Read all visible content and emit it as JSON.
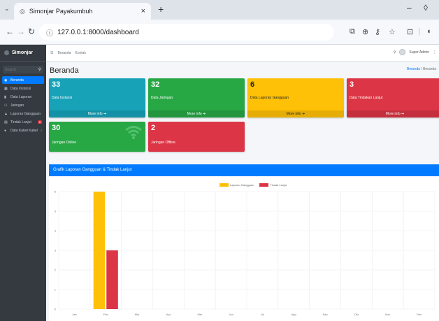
{
  "browser": {
    "tab_title": "Simonjar Payakumbuh",
    "tab_close": "×",
    "new_tab": "+",
    "menu_icon": "chevron-down-icon",
    "url": "127.0.0.1:8000/dashboard",
    "win_minimize": "–",
    "win_restore": "◊"
  },
  "sidebar": {
    "brand": "Simonjar",
    "search_placeholder": "Search",
    "items": [
      {
        "label": "Beranda",
        "icon": "◉"
      },
      {
        "label": "Data Instansi",
        "icon": "▦"
      },
      {
        "label": "Data Laporan",
        "icon": "▮"
      },
      {
        "label": "Jaringan",
        "icon": "⚇"
      },
      {
        "label": "Laporan Gangguan",
        "icon": "▲",
        "arrow": "‹"
      },
      {
        "label": "Tindak Lanjut",
        "icon": "▤",
        "badge": "6"
      },
      {
        "label": "Data Kabel Kabel",
        "icon": "●",
        "arrow": "‹"
      }
    ]
  },
  "topbar": {
    "menu_icon": "☰",
    "links": [
      "Beranda",
      "Kontak"
    ],
    "user": "Super Admin"
  },
  "page": {
    "title": "Beranda",
    "breadcrumb_link": "Beranda",
    "breadcrumb_sep": "/",
    "breadcrumb_current": "Beranda"
  },
  "stats": [
    {
      "value": "33",
      "label": "Data Instansi",
      "link": "More info",
      "color": "#17a2b8"
    },
    {
      "value": "32",
      "label": "Data Jaringan",
      "link": "More info",
      "color": "#28a745"
    },
    {
      "value": "6",
      "label": "Data Laporan Gangguan",
      "link": "More info",
      "color": "#ffc107"
    },
    {
      "value": "3",
      "label": "Data Tindakan Lanjut",
      "link": "More info",
      "color": "#dc3545"
    }
  ],
  "status": [
    {
      "value": "30",
      "label": "Jaringan Online",
      "color": "#28a745"
    },
    {
      "value": "2",
      "label": "Jaringan Offline",
      "color": "#dc3545"
    }
  ],
  "chart_card_title": "Grafik Laporan Gangguan & Tindak Lanjut",
  "chart_data": {
    "type": "bar",
    "categories": [
      "Jan",
      "Feb",
      "Mar",
      "Apr",
      "Mei",
      "Jun",
      "Jul",
      "Agu",
      "Sep",
      "Okt",
      "Nov",
      "Des"
    ],
    "series": [
      {
        "name": "Laporan Gangguan",
        "values": [
          0,
          6,
          0,
          0,
          0,
          0,
          0,
          0,
          0,
          0,
          0,
          0
        ],
        "color": "#ffc107"
      },
      {
        "name": "Tindak Lanjut",
        "values": [
          0,
          3,
          0,
          0,
          0,
          0,
          0,
          0,
          0,
          0,
          0,
          0
        ],
        "color": "#dc3545"
      }
    ],
    "yticks": [
      "0",
      "1",
      "2",
      "3",
      "4",
      "5",
      "6"
    ],
    "ylim": [
      0,
      6
    ],
    "grid": true,
    "legend": "top-center"
  }
}
